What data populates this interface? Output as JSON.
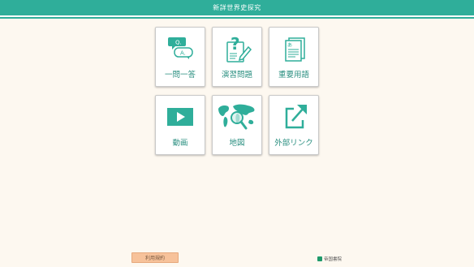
{
  "header": {
    "title": "新詳世界史探究"
  },
  "tiles": [
    {
      "label": "一問一答",
      "icon": "qa-bubbles-icon"
    },
    {
      "label": "演習問題",
      "icon": "question-notepad-pencil-icon"
    },
    {
      "label": "重要用語",
      "icon": "stacked-pages-icon"
    },
    {
      "label": "動画",
      "icon": "video-play-icon"
    },
    {
      "label": "地図",
      "icon": "world-map-magnifier-icon"
    },
    {
      "label": "外部リンク",
      "icon": "external-link-arrow-icon"
    }
  ],
  "icon_text": {
    "q": "Q.",
    "a": "A.",
    "page_glyph": "あ",
    "question_mark": "?"
  },
  "footer": {
    "terms_label": "利用規約",
    "publisher": "帝国書院"
  },
  "colors": {
    "accent": "#2fae9a",
    "label": "#2a8f80",
    "background": "#fdf8f0",
    "terms_button": "#f7c29a"
  }
}
